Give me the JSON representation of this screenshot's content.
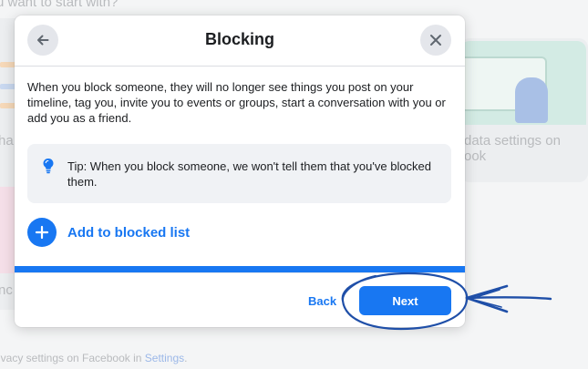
{
  "background": {
    "heading": "u want to start with?",
    "left_texts": [
      "ha",
      "nc"
    ],
    "right_card_text": "data settings on ook",
    "footer_prefix": "ivacy settings on Facebook in ",
    "footer_link": "Settings",
    "footer_suffix": "."
  },
  "dialog": {
    "title": "Blocking",
    "back_icon": "arrow-left-icon",
    "close_icon": "close-icon",
    "description": "When you block someone, they will no longer see things you post on your timeline, tag you, invite you to events or groups, start a conversation with you or add you as a friend.",
    "tip": {
      "icon": "lightbulb-icon",
      "text": "Tip: When you block someone, we won't tell them that you've blocked them."
    },
    "add_to_list": {
      "icon": "plus-icon",
      "label": "Add to blocked list"
    },
    "progress_fraction": 1.0,
    "footer": {
      "back_label": "Back",
      "next_label": "Next"
    }
  },
  "colors": {
    "accent": "#1877f2",
    "annotation": "#1f4fa8"
  }
}
